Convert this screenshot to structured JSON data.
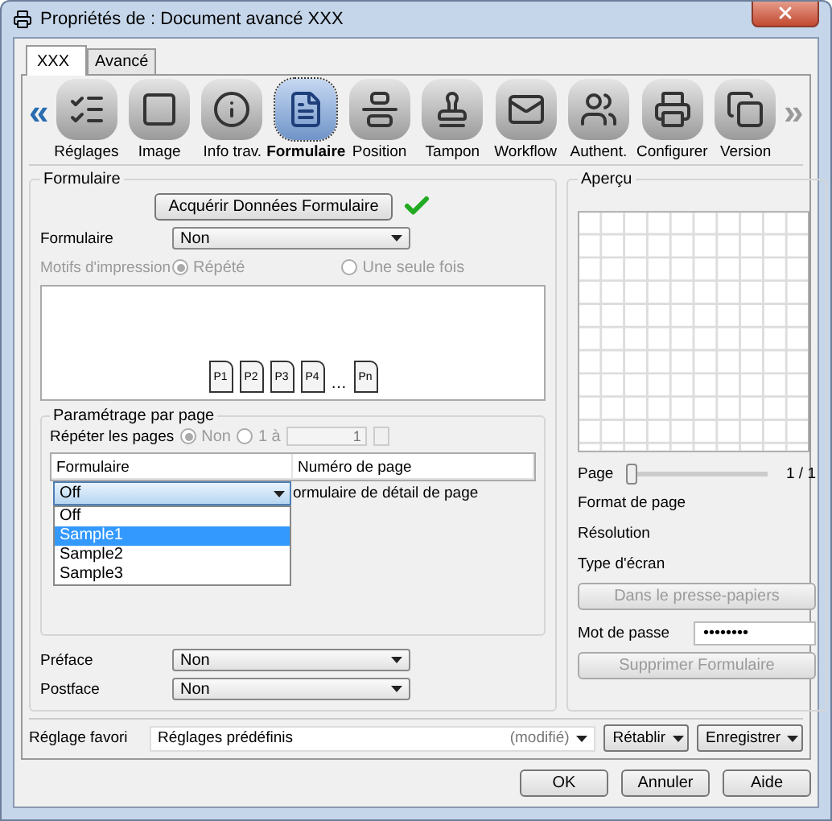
{
  "window": {
    "title": "Propriétés de : Document avancé XXX"
  },
  "tabs": [
    {
      "label": "XXX",
      "selected": true
    },
    {
      "label": "Avancé",
      "selected": false
    }
  ],
  "toolbar": {
    "prev": {
      "label": "«",
      "disabled": false
    },
    "next": {
      "label": "»",
      "disabled": true
    },
    "items": [
      {
        "label": "Réglages",
        "selected": false
      },
      {
        "label": "Image",
        "selected": false
      },
      {
        "label": "Info trav.",
        "selected": false
      },
      {
        "label": "Formulaire",
        "selected": true
      },
      {
        "label": "Position",
        "selected": false
      },
      {
        "label": "Tampon",
        "selected": false
      },
      {
        "label": "Workflow",
        "selected": false
      },
      {
        "label": "Authent.",
        "selected": false
      },
      {
        "label": "Configurer",
        "selected": false
      },
      {
        "label": "Version",
        "selected": false
      }
    ]
  },
  "form_group": {
    "title": "Formulaire",
    "acquire_button": "Acquérir Données Formulaire",
    "acquired": true,
    "form_label": "Formulaire",
    "form_value": "Non",
    "pattern": {
      "label": "Motifs d'impression",
      "disabled": true,
      "options": [
        {
          "label": "Répété",
          "selected": true
        },
        {
          "label": "Une seule fois",
          "selected": false
        }
      ]
    },
    "pages": [
      {
        "kind": "page",
        "label": "P1"
      },
      {
        "kind": "page",
        "label": "P2"
      },
      {
        "kind": "page",
        "label": "P3"
      },
      {
        "kind": "page",
        "label": "P4"
      },
      {
        "kind": "gap",
        "label": "…"
      },
      {
        "kind": "page",
        "label": "Pn"
      }
    ]
  },
  "page_settings": {
    "title": "Paramétrage par page",
    "repeat_label": "Répéter les pages",
    "disabled": true,
    "options": [
      {
        "label": "Non",
        "selected": true
      },
      {
        "label": "1 à",
        "selected": false
      }
    ],
    "repeat_value": "1",
    "columns": [
      "Formulaire",
      "Numéro de page"
    ],
    "row": {
      "form": "Off",
      "page": "ormulaire de détail de page"
    },
    "dropdown": {
      "open": true,
      "options": [
        {
          "label": "Off",
          "selected": false
        },
        {
          "label": "Sample1",
          "selected": true
        },
        {
          "label": "Sample2",
          "selected": false
        },
        {
          "label": "Sample3",
          "selected": false
        }
      ]
    }
  },
  "preface": {
    "label": "Préface",
    "value": "Non"
  },
  "postface": {
    "label": "Postface",
    "value": "Non"
  },
  "preview": {
    "title": "Aperçu",
    "page_label": "Page",
    "level": 0,
    "page_reading": "1 / 1",
    "info": [
      "Format de page",
      "Résolution",
      "Type d'écran"
    ],
    "clipboard_button": {
      "label": "Dans le presse-papiers",
      "disabled": true
    },
    "password_label": "Mot de passe",
    "password": "••••••••",
    "delete_button": {
      "label": "Supprimer Formulaire",
      "disabled": true
    }
  },
  "favorite": {
    "label": "Réglage favori",
    "value": "Réglages prédéfinis",
    "modified": "(modifié)",
    "reset": "Rétablir",
    "save": "Enregistrer"
  },
  "buttons": [
    "OK",
    "Annuler",
    "Aide"
  ]
}
